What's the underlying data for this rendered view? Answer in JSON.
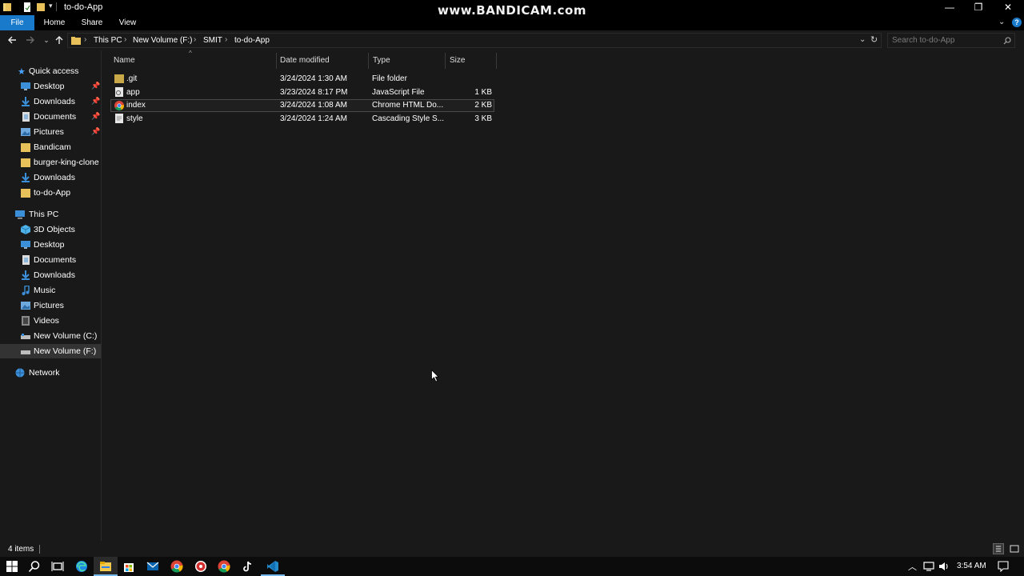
{
  "window": {
    "title": "to-do-App",
    "watermark": "www.BANDICAM.com",
    "controls": {
      "minimize": "—",
      "restore": "❐",
      "close": "✕"
    }
  },
  "ribbon": {
    "tabs": [
      "File",
      "Home",
      "Share",
      "View"
    ]
  },
  "address": {
    "crumbs": [
      "This PC",
      "New Volume (F:)",
      "SMIT",
      "to-do-App"
    ],
    "search_placeholder": "Search to-do-App"
  },
  "nav": {
    "quick_access_label": "Quick access",
    "quick_access": [
      {
        "label": "Desktop",
        "icon": "desktop-icon",
        "pinned": true
      },
      {
        "label": "Downloads",
        "icon": "download-icon",
        "pinned": true
      },
      {
        "label": "Documents",
        "icon": "documents-icon",
        "pinned": true
      },
      {
        "label": "Pictures",
        "icon": "pictures-icon",
        "pinned": true
      },
      {
        "label": "Bandicam",
        "icon": "folder-icon",
        "pinned": false
      },
      {
        "label": "burger-king-clone",
        "icon": "folder-icon",
        "pinned": false
      },
      {
        "label": "Downloads",
        "icon": "download-icon",
        "pinned": false
      },
      {
        "label": "to-do-App",
        "icon": "folder-icon",
        "pinned": false
      }
    ],
    "this_pc_label": "This PC",
    "this_pc": [
      {
        "label": "3D Objects",
        "icon": "3d-objects-icon"
      },
      {
        "label": "Desktop",
        "icon": "desktop-icon"
      },
      {
        "label": "Documents",
        "icon": "documents-icon"
      },
      {
        "label": "Downloads",
        "icon": "download-icon"
      },
      {
        "label": "Music",
        "icon": "music-icon"
      },
      {
        "label": "Pictures",
        "icon": "pictures-icon"
      },
      {
        "label": "Videos",
        "icon": "videos-icon"
      },
      {
        "label": "New Volume (C:)",
        "icon": "drive-icon"
      },
      {
        "label": "New Volume (F:)",
        "icon": "drive-icon",
        "selected": true
      }
    ],
    "network_label": "Network"
  },
  "files": {
    "columns": {
      "name": "Name",
      "date": "Date modified",
      "type": "Type",
      "size": "Size"
    },
    "rows": [
      {
        "name": ".git",
        "date": "3/24/2024 1:30 AM",
        "type": "File folder",
        "size": "",
        "icon": "folder-icon"
      },
      {
        "name": "app",
        "date": "3/23/2024 8:17 PM",
        "type": "JavaScript File",
        "size": "1 KB",
        "icon": "script-file-icon"
      },
      {
        "name": "index",
        "date": "3/24/2024 1:08 AM",
        "type": "Chrome HTML Do...",
        "size": "2 KB",
        "icon": "chrome-icon",
        "focused": true
      },
      {
        "name": "style",
        "date": "3/24/2024 1:24 AM",
        "type": "Cascading Style S...",
        "size": "3 KB",
        "icon": "text-file-icon"
      }
    ]
  },
  "status": {
    "item_count": "4 items"
  },
  "taskbar": {
    "apps": [
      "windows-start-icon",
      "search-icon",
      "task-view-icon",
      "edge-icon",
      "file-explorer-icon",
      "store-icon",
      "mail-icon",
      "chrome-icon",
      "bandicam-icon",
      "chrome-icon",
      "tiktok-icon",
      "vscode-icon"
    ],
    "clock": "3:54 AM"
  },
  "colors": {
    "accent": "#1979ca",
    "background": "#191919",
    "selection": "#3a3a3a"
  }
}
